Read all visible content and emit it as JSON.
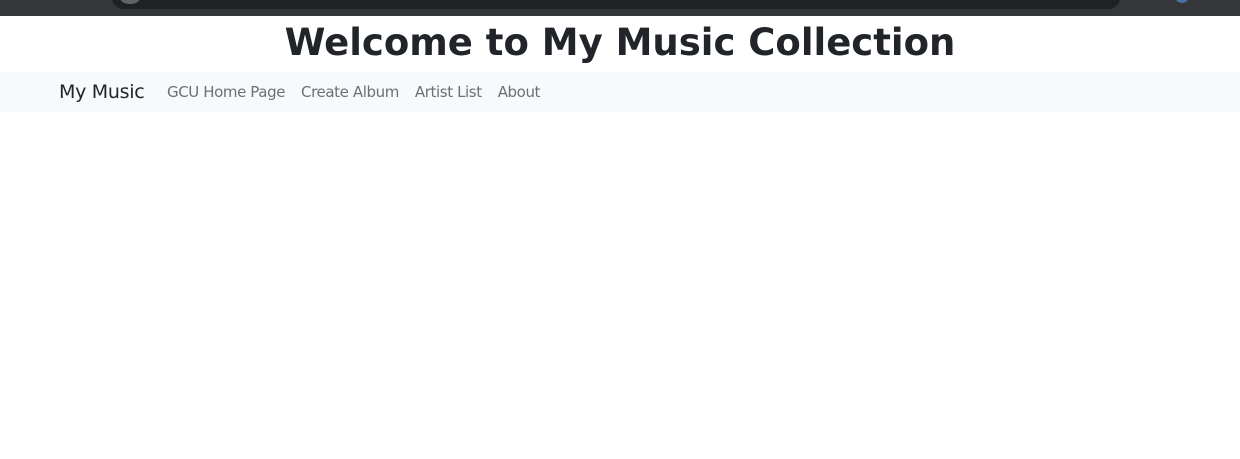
{
  "page": {
    "title": "Welcome to My Music Collection"
  },
  "navbar": {
    "brand": "My Music",
    "links": [
      {
        "label": "GCU Home Page"
      },
      {
        "label": "Create Album"
      },
      {
        "label": "Artist List"
      },
      {
        "label": "About"
      }
    ]
  },
  "colors": {
    "navbar_bg": "#f8f9fa",
    "text_dark": "#212529",
    "nav_link": "#6c6f73",
    "browser_chrome": "#35363a"
  }
}
